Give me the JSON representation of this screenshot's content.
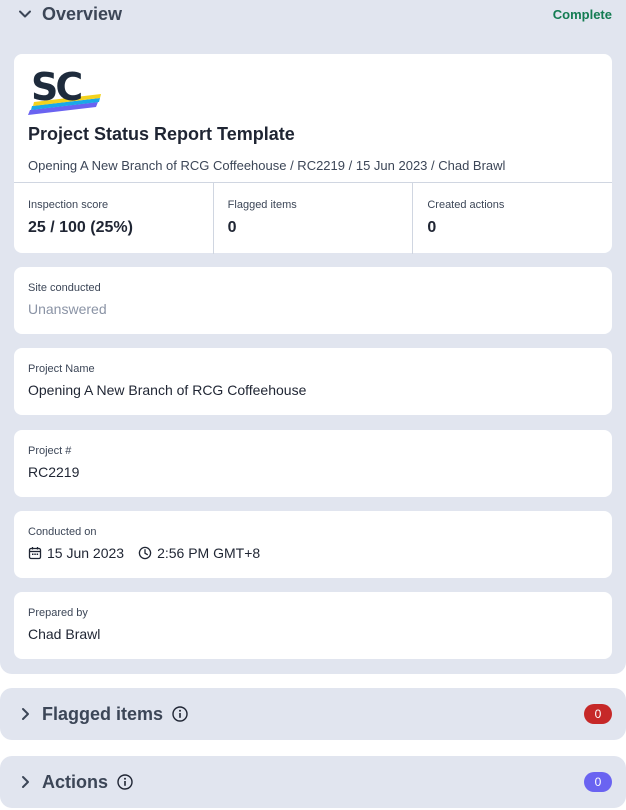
{
  "overview": {
    "title": "Overview",
    "status": "Complete",
    "logo_text": "SC",
    "report_title": "Project Status Report Template",
    "report_subtitle": "Opening A New Branch of RCG Coffeehouse / RC2219 / 15 Jun 2023 / Chad Brawl",
    "stats": [
      {
        "label": "Inspection score",
        "value": "25 / 100 (25%)"
      },
      {
        "label": "Flagged items",
        "value": "0"
      },
      {
        "label": "Created actions",
        "value": "0"
      }
    ],
    "fields": {
      "site": {
        "label": "Site conducted",
        "value": "Unanswered"
      },
      "project_name": {
        "label": "Project Name",
        "value": "Opening A New Branch of RCG Coffeehouse"
      },
      "project_number": {
        "label": "Project #",
        "value": "RC2219"
      },
      "conducted_on": {
        "label": "Conducted on",
        "date": "15 Jun 2023",
        "time": "2:56 PM GMT+8"
      },
      "prepared_by": {
        "label": "Prepared by",
        "value": "Chad Brawl"
      }
    }
  },
  "flagged": {
    "title": "Flagged items",
    "count": "0"
  },
  "actions": {
    "title": "Actions",
    "count": "0"
  },
  "colors": {
    "section_bg": "#e1e5ef",
    "card_bg": "#ffffff",
    "complete": "#137c52",
    "flagged_badge": "#c62828",
    "actions_badge": "#6a63f1"
  }
}
